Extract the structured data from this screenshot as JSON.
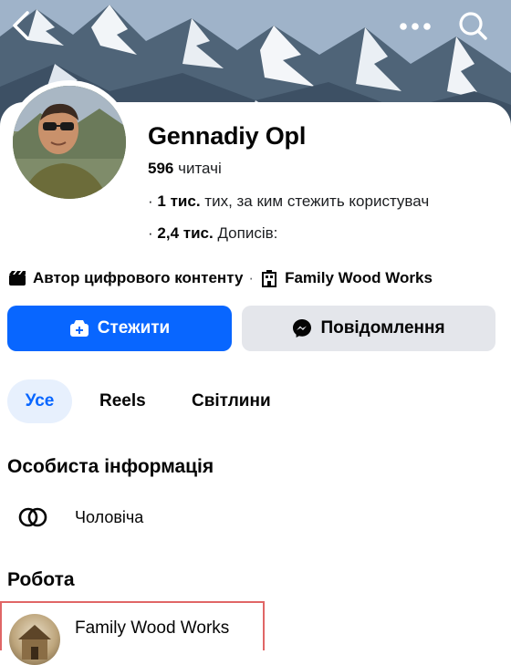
{
  "profile": {
    "name": "Gennadiy Opl",
    "followers_count": "596",
    "followers_label": "читачі",
    "following_count": "1 тис.",
    "following_label": "тих, за ким стежить користувач",
    "posts_count": "2,4 тис.",
    "posts_label": "Дописів:"
  },
  "meta": {
    "category": "Автор цифрового контенту",
    "separator": "·",
    "workplace": "Family Wood Works"
  },
  "actions": {
    "follow_label": "Стежити",
    "message_label": "Повідомлення"
  },
  "tabs": [
    {
      "label": "Усе",
      "active": true
    },
    {
      "label": "Reels",
      "active": false
    },
    {
      "label": "Світлини",
      "active": false
    }
  ],
  "sections": {
    "personal_title": "Особиста інформація",
    "gender": "Чоловіча",
    "work_title": "Робота",
    "work_place": "Family Wood Works"
  },
  "icons": {
    "back": "chevron-left-icon",
    "more": "more-dots-icon",
    "search": "search-icon",
    "category": "clapperboard-icon",
    "workplace": "building-icon",
    "follow": "follow-plus-icon",
    "message": "messenger-icon",
    "gender": "gender-rings-icon"
  },
  "colors": {
    "accent": "#0866ff",
    "secondary_button": "#e4e6eb",
    "active_tab_bg": "#e7f0fd",
    "highlight_border": "#e06666"
  }
}
